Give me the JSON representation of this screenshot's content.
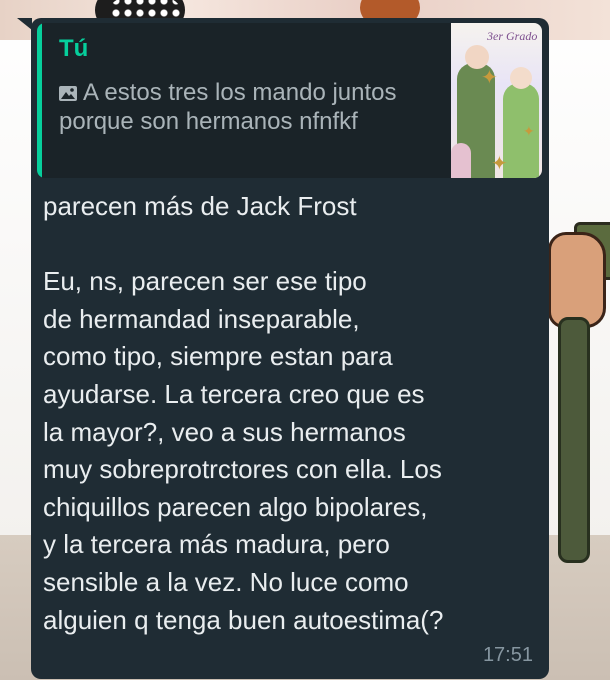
{
  "reply": {
    "author": "Tú",
    "icon": "photo-icon",
    "text": "A estos tres los mando juntos porque son hermanos nfnfkf",
    "thumbnail_label": "3er Grado"
  },
  "message": {
    "text": "parecen más de Jack Frost\n\nEu, ns, parecen ser ese tipo\nde hermandad inseparable,\ncomo tipo, siempre estan para\nayudarse. La tercera creo que es\nla mayor?, veo a sus hermanos\nmuy sobreprotrctores con ella. Los\nchiquillos parecen algo bipolares,\ny la tercera más madura, pero\nsensible a la vez. No luce como\nalguien q tenga buen autoestima(?",
    "time": "17:51"
  },
  "colors": {
    "bubble": "#1f2c34",
    "accent": "#06cf9c",
    "text": "#e9edef",
    "meta": "#8696a0"
  }
}
